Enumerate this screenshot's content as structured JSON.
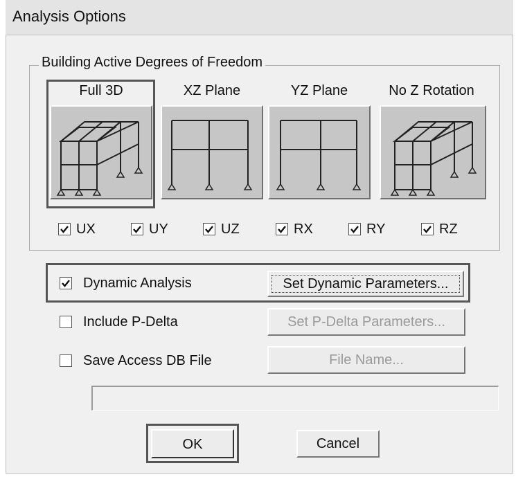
{
  "window": {
    "title": "Analysis Options"
  },
  "dof": {
    "group_label": "Building Active Degrees of Freedom",
    "views": [
      {
        "label": "Full 3D",
        "icon": "frame-3d-icon"
      },
      {
        "label": "XZ Plane",
        "icon": "frame-2d-icon"
      },
      {
        "label": "YZ Plane",
        "icon": "frame-2d-icon"
      },
      {
        "label": "No Z Rotation",
        "icon": "frame-3d-icon"
      }
    ],
    "selected_view": "Full 3D",
    "checkboxes": [
      {
        "label": "UX",
        "checked": true
      },
      {
        "label": "UY",
        "checked": true
      },
      {
        "label": "UZ",
        "checked": true
      },
      {
        "label": "RX",
        "checked": true
      },
      {
        "label": "RY",
        "checked": true
      },
      {
        "label": "RZ",
        "checked": true
      }
    ]
  },
  "options": {
    "dynamic": {
      "label": "Dynamic Analysis",
      "checked": true,
      "button": "Set Dynamic Parameters..."
    },
    "pdelta": {
      "label": "Include P-Delta",
      "checked": false,
      "button": "Set P-Delta Parameters..."
    },
    "accessdb": {
      "label": "Save Access DB File",
      "checked": false,
      "button": "File Name..."
    }
  },
  "buttons": {
    "ok": "OK",
    "cancel": "Cancel"
  }
}
